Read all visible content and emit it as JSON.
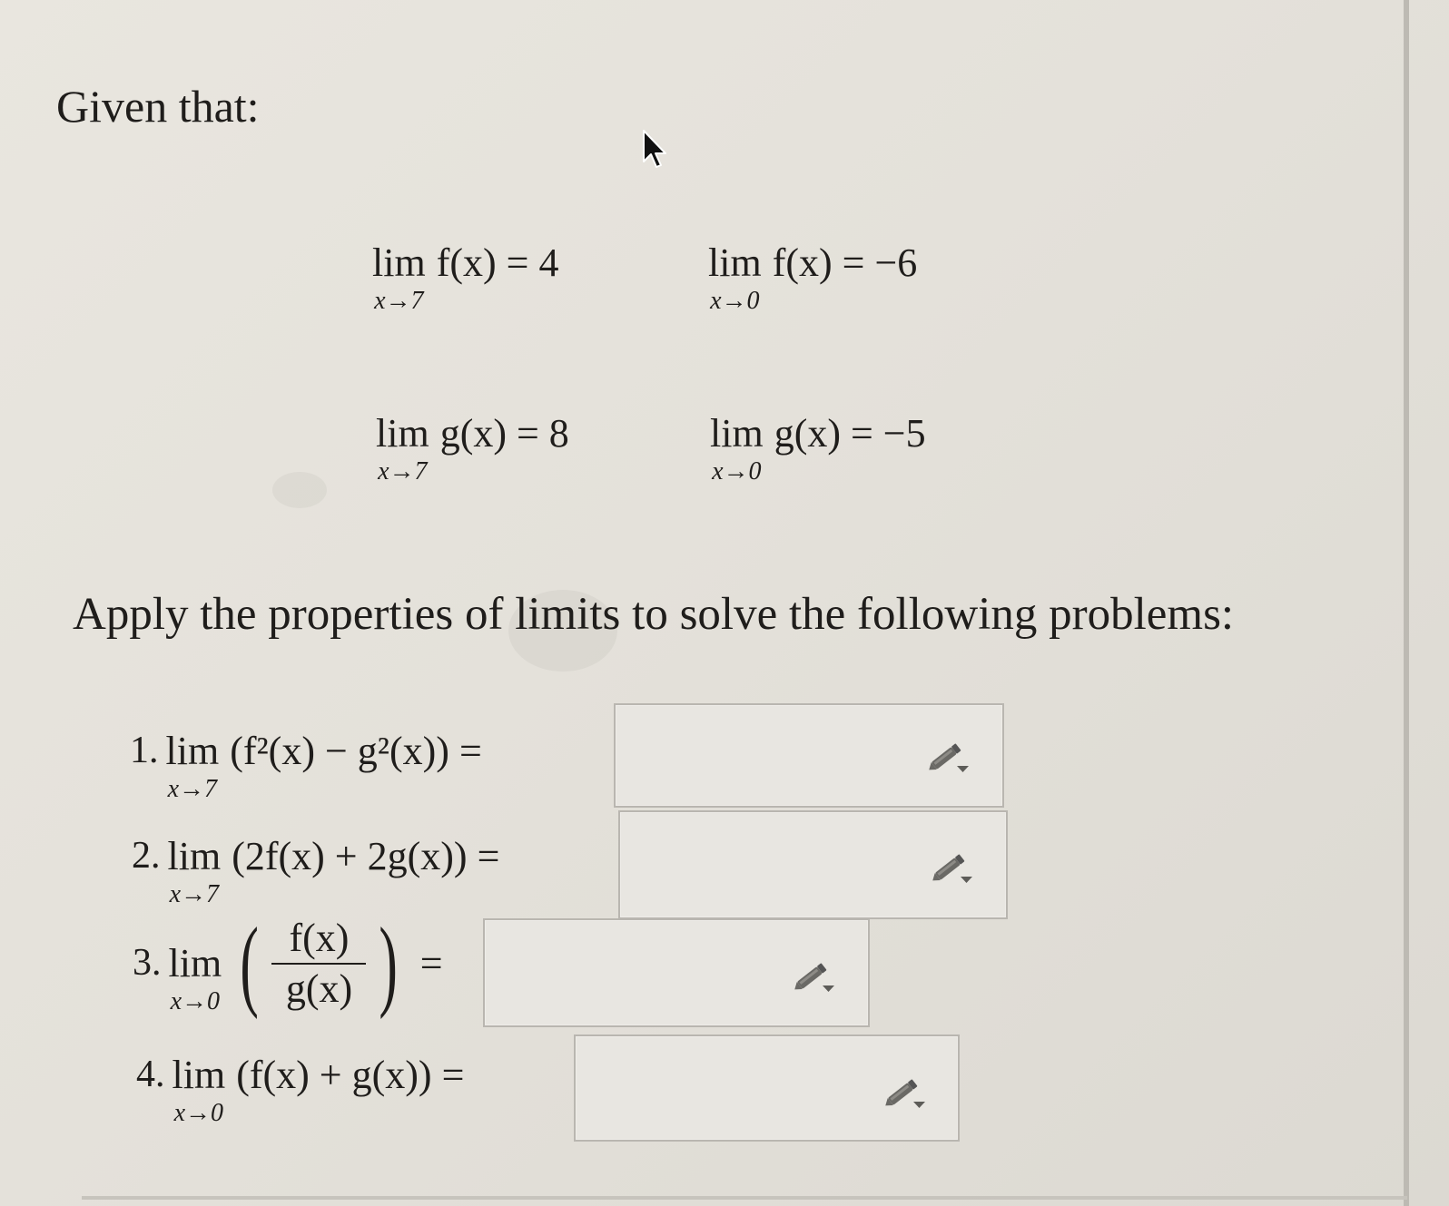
{
  "heading": "Given that:",
  "instruction": "Apply the properties of limits to solve the following problems:",
  "given": [
    {
      "lim": "lim",
      "sub": "x→7",
      "expr": "f(x) = 4"
    },
    {
      "lim": "lim",
      "sub": "x→0",
      "expr": "f(x) = −6"
    },
    {
      "lim": "lim",
      "sub": "x→7",
      "expr": "g(x) = 8"
    },
    {
      "lim": "lim",
      "sub": "x→0",
      "expr": "g(x) = −5"
    }
  ],
  "problems": [
    {
      "number": "1.",
      "lim": "lim",
      "sub": "x→7",
      "expr": "(f²(x) − g²(x)) =",
      "answer": ""
    },
    {
      "number": "2.",
      "lim": "lim",
      "sub": "x→7",
      "expr": "(2f(x) + 2g(x)) =",
      "answer": ""
    },
    {
      "number": "3.",
      "lim": "lim",
      "sub": "x→0",
      "numerator": "f(x)",
      "denominator": "g(x)",
      "equals": "=",
      "answer": ""
    },
    {
      "number": "4.",
      "lim": "lim",
      "sub": "x→0",
      "expr": "(f(x) + g(x)) =",
      "answer": ""
    }
  ],
  "icons": {
    "answer_tool": "pencil-icon",
    "pointer": "mouse-cursor-icon"
  }
}
